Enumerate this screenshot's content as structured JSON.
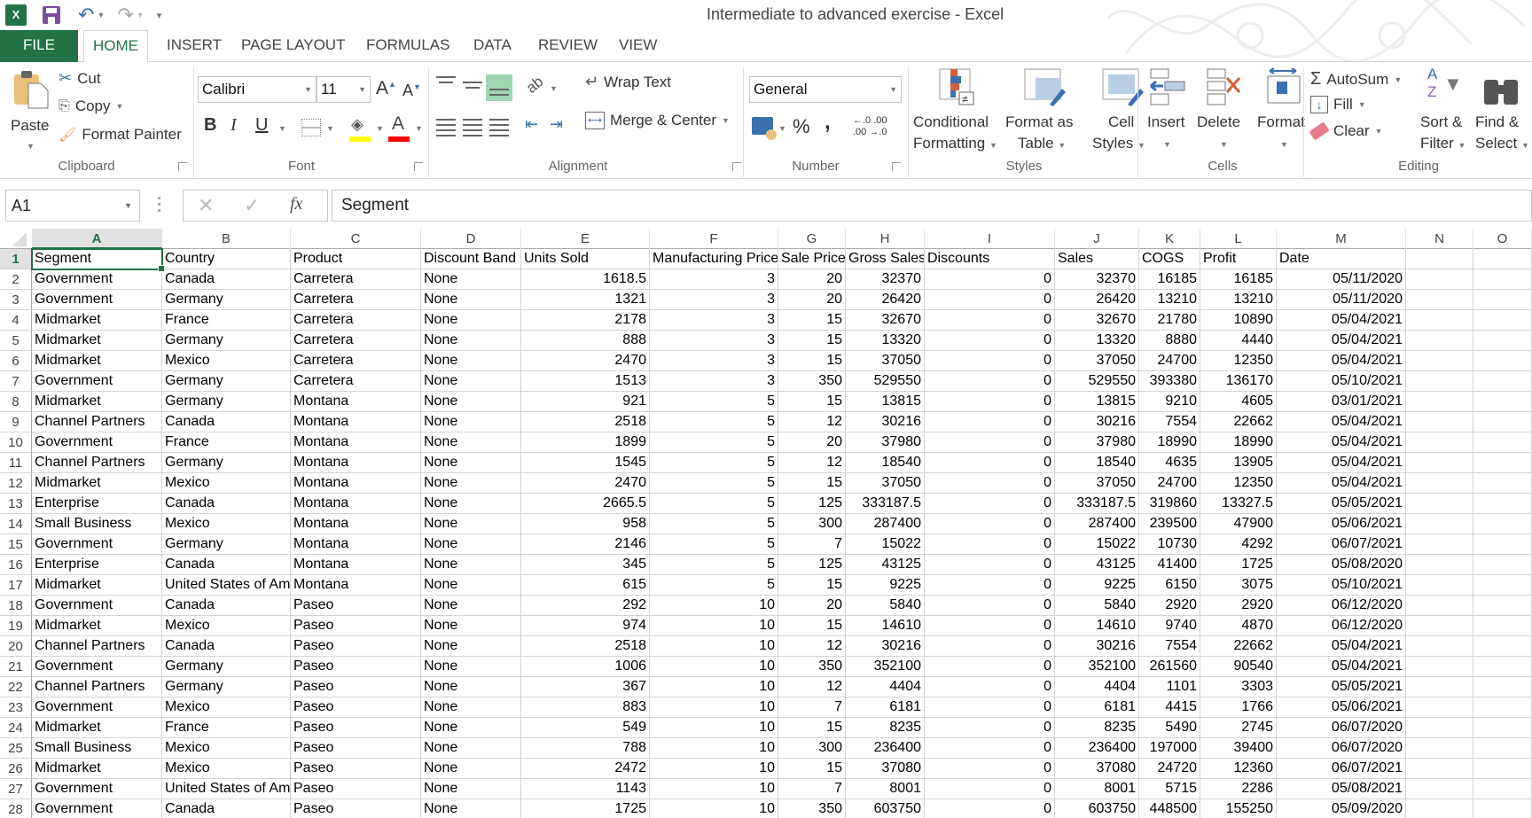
{
  "app": {
    "title": "Intermediate to advanced exercise - Excel",
    "accent_color": "#217346"
  },
  "quick_access": {
    "icons": [
      "excel-logo-icon",
      "save-icon",
      "undo-icon",
      "redo-icon",
      "customize-qat-icon"
    ]
  },
  "tabs": [
    {
      "label": "FILE"
    },
    {
      "label": "HOME",
      "active": true
    },
    {
      "label": "INSERT"
    },
    {
      "label": "PAGE LAYOUT"
    },
    {
      "label": "FORMULAS"
    },
    {
      "label": "DATA"
    },
    {
      "label": "REVIEW"
    },
    {
      "label": "VIEW"
    }
  ],
  "ribbon": {
    "clipboard": {
      "label": "Clipboard",
      "paste": "Paste",
      "cut": "Cut",
      "copy": "Copy",
      "format_painter": "Format Painter"
    },
    "font": {
      "label": "Font",
      "font_name": "Calibri",
      "font_size": "11",
      "bold": "B",
      "italic": "I",
      "underline": "U",
      "font_color_letter": "A",
      "fill_color": "#ffff00",
      "font_color": "#ff0000"
    },
    "alignment": {
      "label": "Alignment",
      "wrap_text": "Wrap Text",
      "merge_center": "Merge & Center"
    },
    "number": {
      "label": "Number",
      "format": "General",
      "percent": "%",
      "comma": ",",
      "increase_decimal": "←.0 .00",
      "decrease_decimal": ".00 →.0"
    },
    "styles": {
      "label": "Styles",
      "conditional_formatting": [
        "Conditional",
        "Formatting"
      ],
      "format_as_table": [
        "Format as",
        "Table"
      ],
      "cell_styles": [
        "Cell",
        "Styles"
      ]
    },
    "cells": {
      "label": "Cells",
      "insert": "Insert",
      "delete": "Delete",
      "format": "Format"
    },
    "editing": {
      "label": "Editing",
      "autosum": "AutoSum",
      "fill": "Fill",
      "clear": "Clear",
      "sort_filter": [
        "Sort &",
        "Filter"
      ],
      "find_select": [
        "Find &",
        "Select"
      ]
    }
  },
  "formula_bar": {
    "name_box": "A1",
    "cancel_icon": "✕",
    "enter_icon": "✓",
    "fx": "fx",
    "value": "Segment"
  },
  "sheet": {
    "selected_cell": "A1",
    "column_letters": [
      "A",
      "B",
      "C",
      "D",
      "E",
      "F",
      "G",
      "H",
      "I",
      "J",
      "K",
      "L",
      "M",
      "N",
      "O"
    ],
    "headers": [
      "Segment",
      "Country",
      "Product",
      "Discount Band",
      "Units Sold",
      "Manufacturing Price",
      "Sale Price",
      "Gross Sales",
      "Discounts",
      "Sales",
      "COGS",
      "Profit",
      "Date"
    ],
    "rows": [
      [
        "Government",
        "Canada",
        "Carretera",
        "None",
        "1618.5",
        "3",
        "20",
        "32370",
        "0",
        "32370",
        "16185",
        "16185",
        "05/11/2020"
      ],
      [
        "Government",
        "Germany",
        "Carretera",
        "None",
        "1321",
        "3",
        "20",
        "26420",
        "0",
        "26420",
        "13210",
        "13210",
        "05/11/2020"
      ],
      [
        "Midmarket",
        "France",
        "Carretera",
        "None",
        "2178",
        "3",
        "15",
        "32670",
        "0",
        "32670",
        "21780",
        "10890",
        "05/04/2021"
      ],
      [
        "Midmarket",
        "Germany",
        "Carretera",
        "None",
        "888",
        "3",
        "15",
        "13320",
        "0",
        "13320",
        "8880",
        "4440",
        "05/04/2021"
      ],
      [
        "Midmarket",
        "Mexico",
        "Carretera",
        "None",
        "2470",
        "3",
        "15",
        "37050",
        "0",
        "37050",
        "24700",
        "12350",
        "05/04/2021"
      ],
      [
        "Government",
        "Germany",
        "Carretera",
        "None",
        "1513",
        "3",
        "350",
        "529550",
        "0",
        "529550",
        "393380",
        "136170",
        "05/10/2021"
      ],
      [
        "Midmarket",
        "Germany",
        "Montana",
        "None",
        "921",
        "5",
        "15",
        "13815",
        "0",
        "13815",
        "9210",
        "4605",
        "03/01/2021"
      ],
      [
        "Channel Partners",
        "Canada",
        "Montana",
        "None",
        "2518",
        "5",
        "12",
        "30216",
        "0",
        "30216",
        "7554",
        "22662",
        "05/04/2021"
      ],
      [
        "Government",
        "France",
        "Montana",
        "None",
        "1899",
        "5",
        "20",
        "37980",
        "0",
        "37980",
        "18990",
        "18990",
        "05/04/2021"
      ],
      [
        "Channel Partners",
        "Germany",
        "Montana",
        "None",
        "1545",
        "5",
        "12",
        "18540",
        "0",
        "18540",
        "4635",
        "13905",
        "05/04/2021"
      ],
      [
        "Midmarket",
        "Mexico",
        "Montana",
        "None",
        "2470",
        "5",
        "15",
        "37050",
        "0",
        "37050",
        "24700",
        "12350",
        "05/04/2021"
      ],
      [
        "Enterprise",
        "Canada",
        "Montana",
        "None",
        "2665.5",
        "5",
        "125",
        "333187.5",
        "0",
        "333187.5",
        "319860",
        "13327.5",
        "05/05/2021"
      ],
      [
        "Small Business",
        "Mexico",
        "Montana",
        "None",
        "958",
        "5",
        "300",
        "287400",
        "0",
        "287400",
        "239500",
        "47900",
        "05/06/2021"
      ],
      [
        "Government",
        "Germany",
        "Montana",
        "None",
        "2146",
        "5",
        "7",
        "15022",
        "0",
        "15022",
        "10730",
        "4292",
        "06/07/2021"
      ],
      [
        "Enterprise",
        "Canada",
        "Montana",
        "None",
        "345",
        "5",
        "125",
        "43125",
        "0",
        "43125",
        "41400",
        "1725",
        "05/08/2020"
      ],
      [
        "Midmarket",
        "United States of America",
        "Montana",
        "None",
        "615",
        "5",
        "15",
        "9225",
        "0",
        "9225",
        "6150",
        "3075",
        "05/10/2021"
      ],
      [
        "Government",
        "Canada",
        "Paseo",
        "None",
        "292",
        "10",
        "20",
        "5840",
        "0",
        "5840",
        "2920",
        "2920",
        "06/12/2020"
      ],
      [
        "Midmarket",
        "Mexico",
        "Paseo",
        "None",
        "974",
        "10",
        "15",
        "14610",
        "0",
        "14610",
        "9740",
        "4870",
        "06/12/2020"
      ],
      [
        "Channel Partners",
        "Canada",
        "Paseo",
        "None",
        "2518",
        "10",
        "12",
        "30216",
        "0",
        "30216",
        "7554",
        "22662",
        "05/04/2021"
      ],
      [
        "Government",
        "Germany",
        "Paseo",
        "None",
        "1006",
        "10",
        "350",
        "352100",
        "0",
        "352100",
        "261560",
        "90540",
        "05/04/2021"
      ],
      [
        "Channel Partners",
        "Germany",
        "Paseo",
        "None",
        "367",
        "10",
        "12",
        "4404",
        "0",
        "4404",
        "1101",
        "3303",
        "05/05/2021"
      ],
      [
        "Government",
        "Mexico",
        "Paseo",
        "None",
        "883",
        "10",
        "7",
        "6181",
        "0",
        "6181",
        "4415",
        "1766",
        "05/06/2021"
      ],
      [
        "Midmarket",
        "France",
        "Paseo",
        "None",
        "549",
        "10",
        "15",
        "8235",
        "0",
        "8235",
        "5490",
        "2745",
        "06/07/2020"
      ],
      [
        "Small Business",
        "Mexico",
        "Paseo",
        "None",
        "788",
        "10",
        "300",
        "236400",
        "0",
        "236400",
        "197000",
        "39400",
        "06/07/2020"
      ],
      [
        "Midmarket",
        "Mexico",
        "Paseo",
        "None",
        "2472",
        "10",
        "15",
        "37080",
        "0",
        "37080",
        "24720",
        "12360",
        "06/07/2021"
      ],
      [
        "Government",
        "United States of America",
        "Paseo",
        "None",
        "1143",
        "10",
        "7",
        "8001",
        "0",
        "8001",
        "5715",
        "2286",
        "05/08/2021"
      ],
      [
        "Government",
        "Canada",
        "Paseo",
        "None",
        "1725",
        "10",
        "350",
        "603750",
        "0",
        "603750",
        "448500",
        "155250",
        "05/09/2020"
      ]
    ]
  }
}
